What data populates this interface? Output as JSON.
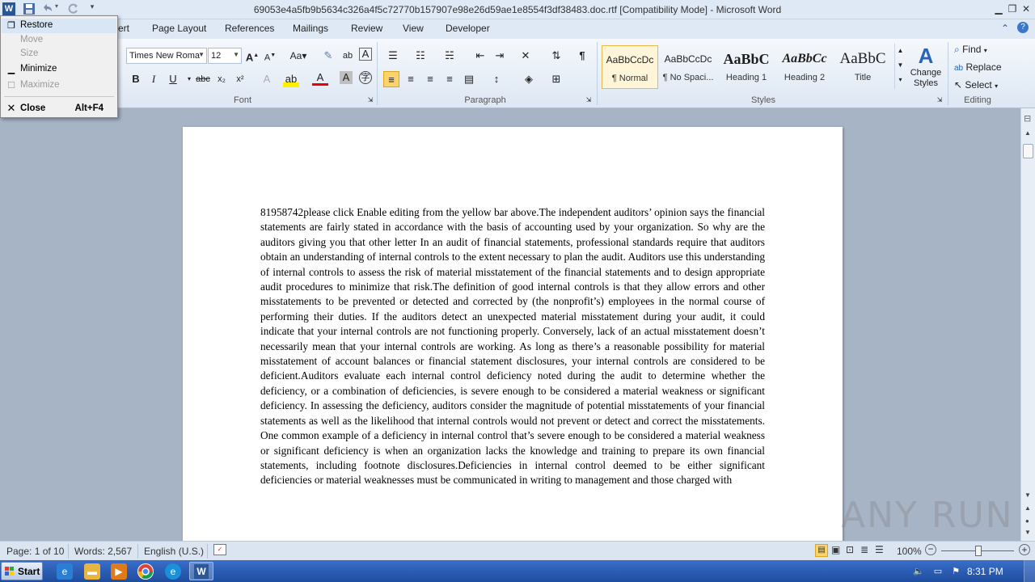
{
  "window": {
    "title": "69053e4a5fb9b5634c326a4f5c72770b157907e98e26d59ae1e8554f3df38483.doc.rtf [Compatibility Mode] - Microsoft Word",
    "app_icon": "word-icon",
    "controls": {
      "minimize": "▁",
      "restore": "❐",
      "close": "✕"
    }
  },
  "system_menu": {
    "items": [
      {
        "label": "Restore",
        "enabled": true,
        "icon": "restore-icon"
      },
      {
        "label": "Move",
        "enabled": false
      },
      {
        "label": "Size",
        "enabled": false
      },
      {
        "label": "Minimize",
        "enabled": true,
        "icon": "minimize-icon"
      },
      {
        "label": "Maximize",
        "enabled": false,
        "icon": "maximize-icon"
      },
      {
        "label": "Close",
        "enabled": true,
        "accel": "Alt+F4",
        "icon": "close-icon"
      }
    ]
  },
  "ribbon": {
    "tabs": [
      "ert",
      "Page Layout",
      "References",
      "Mailings",
      "Review",
      "View",
      "Developer"
    ],
    "font": {
      "name": "Times New Roma",
      "size": "12",
      "group_label": "Font"
    },
    "paragraph": {
      "group_label": "Paragraph"
    },
    "styles": {
      "group_label": "Styles",
      "tiles": [
        {
          "preview": "AaBbCcDc",
          "name": "¶ Normal"
        },
        {
          "preview": "AaBbCcDc",
          "name": "¶ No Spaci..."
        },
        {
          "preview": "AaBbC",
          "name": "Heading 1"
        },
        {
          "preview": "AaBbCc",
          "name": "Heading 2"
        },
        {
          "preview": "AaBbC",
          "name": "Title"
        }
      ],
      "change_styles": [
        "Change",
        "Styles"
      ]
    },
    "editing": {
      "group_label": "Editing",
      "find": "Find",
      "replace": "Replace",
      "select": "Select"
    }
  },
  "document": {
    "body": "81958742please click Enable editing from the yellow bar above.The independent auditors’ opinion says the financial statements are fairly stated in accordance with the basis of accounting used by your organization. So why are the auditors giving you that other letter In an audit of financial statements, professional standards require that auditors obtain an understanding of internal controls to the extent necessary to plan the audit. Auditors use this understanding of internal controls to assess the risk of material misstatement of the financial statements and to design appropriate audit procedures to minimize that risk.The definition of good internal controls is that they allow errors and other misstatements to be prevented or detected and corrected by (the nonprofit’s) employees in the normal course of performing their duties. If the auditors detect an unexpected material misstatement during your audit, it could indicate that your internal controls are not functioning properly. Conversely, lack of an actual misstatement doesn’t necessarily mean that your internal controls are working. As long as there’s a reasonable possibility for material misstatement of account balances or financial statement disclosures, your internal controls are considered to be deficient.Auditors evaluate each internal control deficiency noted during the audit to determine whether the deficiency, or a combination of deficiencies, is severe enough to be considered a material weakness or significant deficiency. In assessing the deficiency, auditors consider the magnitude of potential misstatements of your financial statements as well as the likelihood that internal controls would not prevent or detect and correct the misstatements. One common example of a deficiency in internal control that’s severe enough to be considered a material weakness or significant deficiency is when an organization lacks the knowledge and training to prepare its own financial statements, including footnote disclosures.Deficiencies in internal control deemed to be either significant deficiencies or material weaknesses must be communicated in writing to management and those charged with"
  },
  "statusbar": {
    "page": "Page: 1 of 10",
    "words": "Words: 2,567",
    "language": "English (U.S.)",
    "zoom": "100%"
  },
  "taskbar": {
    "start": "Start",
    "clock": "8:31 PM"
  },
  "watermark": "ANY RUN"
}
